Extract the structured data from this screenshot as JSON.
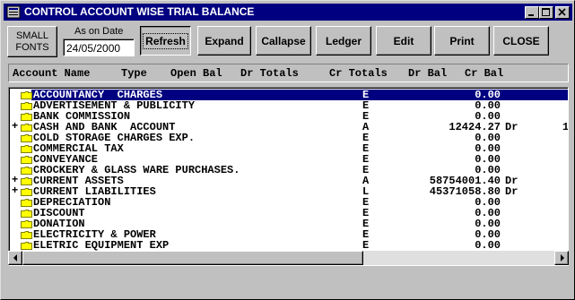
{
  "window": {
    "title": "CONTROL ACCOUNT WISE TRIAL BALANCE"
  },
  "toolbar": {
    "small_fonts": "SMALL\nFONTS",
    "as_on_label": "As on Date",
    "date_value": "24/05/2000",
    "refresh": "Refresh",
    "expand": "Expand",
    "collapse": "Callapse",
    "ledger": "Ledger",
    "edit": "Edit",
    "print": "Print",
    "close": "CLOSE"
  },
  "columns": {
    "account_name": "Account Name",
    "type": "Type",
    "open_bal": "Open Bal",
    "dr_totals": "Dr Totals",
    "cr_totals": "Cr Totals",
    "dr_bal": "Dr Bal",
    "cr_bal": "Cr Bal"
  },
  "rows": [
    {
      "expander": "",
      "name": "ACCOUNTANCY  CHARGES",
      "type": "E",
      "amount": "0.00",
      "drcr": "",
      "extra": "",
      "selected": true
    },
    {
      "expander": "",
      "name": "ADVERTISEMENT & PUBLICITY",
      "type": "E",
      "amount": "0.00",
      "drcr": "",
      "extra": ""
    },
    {
      "expander": "",
      "name": "BANK COMMISSION",
      "type": "E",
      "amount": "0.00",
      "drcr": "",
      "extra": ""
    },
    {
      "expander": "+",
      "name": "CASH AND BANK  ACCOUNT",
      "type": "A",
      "amount": "12424.27",
      "drcr": "Dr",
      "extra": "1"
    },
    {
      "expander": "",
      "name": "COLD STORAGE CHARGES EXP.",
      "type": "E",
      "amount": "0.00",
      "drcr": "",
      "extra": ""
    },
    {
      "expander": "",
      "name": "COMMERCIAL TAX",
      "type": "E",
      "amount": "0.00",
      "drcr": "",
      "extra": ""
    },
    {
      "expander": "",
      "name": "CONVEYANCE",
      "type": "E",
      "amount": "0.00",
      "drcr": "",
      "extra": ""
    },
    {
      "expander": "",
      "name": "CROCKERY & GLASS WARE PURCHASES.",
      "type": "E",
      "amount": "0.00",
      "drcr": "",
      "extra": ""
    },
    {
      "expander": "+",
      "name": "CURRENT ASSETS",
      "type": "A",
      "amount": "58754001.40",
      "drcr": "Dr",
      "extra": ""
    },
    {
      "expander": "+",
      "name": "CURRENT LIABILITIES",
      "type": "L",
      "amount": "45371058.80",
      "drcr": "Dr",
      "extra": ""
    },
    {
      "expander": "",
      "name": "DEPRECIATION",
      "type": "E",
      "amount": "0.00",
      "drcr": "",
      "extra": ""
    },
    {
      "expander": "",
      "name": "DISCOUNT",
      "type": "E",
      "amount": "0.00",
      "drcr": "",
      "extra": ""
    },
    {
      "expander": "",
      "name": "DONATION",
      "type": "E",
      "amount": "0.00",
      "drcr": "",
      "extra": ""
    },
    {
      "expander": "",
      "name": "ELECTRICITY & POWER",
      "type": "E",
      "amount": "0.00",
      "drcr": "",
      "extra": ""
    },
    {
      "expander": "",
      "name": "ELETRIC EQUIPMENT EXP",
      "type": "E",
      "amount": "0.00",
      "drcr": "",
      "extra": ""
    }
  ],
  "colors": {
    "title_bg": "#000080",
    "selection_bg": "#000080",
    "folder": "#ffff00",
    "face": "#c0c0c0"
  },
  "icons": {
    "title": "app-icon",
    "minimize": "minimize-icon",
    "maximize": "maximize-icon",
    "close": "close-icon",
    "folder": "folder-icon"
  }
}
